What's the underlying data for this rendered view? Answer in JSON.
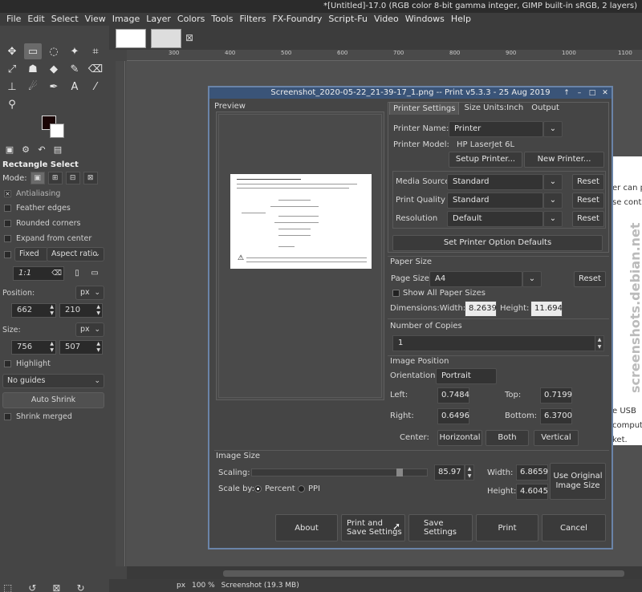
{
  "window": {
    "title": "*[Untitled]-17.0 (RGB color 8-bit gamma integer, GIMP built-in sRGB, 2 layers)"
  },
  "menu": [
    "File",
    "Edit",
    "Select",
    "View",
    "Image",
    "Layer",
    "Colors",
    "Tools",
    "Filters",
    "FX-Foundry",
    "Script-Fu",
    "Video",
    "Windows",
    "Help"
  ],
  "toolbox": {
    "tool_icons": [
      "move",
      "rect-select",
      "lasso",
      "fuzzy-select",
      "crop",
      "transform",
      "warp",
      "bucket",
      "paintbrush",
      "eraser",
      "clone",
      "smudge",
      "path",
      "text",
      "color-picker",
      "zoom"
    ],
    "tool_options": {
      "title": "Rectangle Select",
      "mode_label": "Mode:",
      "antialiasing": "Antialiasing",
      "feather_edges": "Feather edges",
      "rounded_corners": "Rounded corners",
      "expand_from_center": "Expand from center",
      "fixed": "Fixed",
      "fixed_mode": "Aspect ratio",
      "ratio": "1:1",
      "position_label": "Position:",
      "position_unit": "px",
      "pos_x": "662",
      "pos_y": "210",
      "size_label": "Size:",
      "size_unit": "px",
      "size_w": "756",
      "size_h": "507",
      "highlight": "Highlight",
      "guides": "No guides",
      "auto_shrink": "Auto Shrink",
      "shrink_merged": "Shrink merged"
    }
  },
  "ruler": {
    "marks": [
      "300",
      "400",
      "500",
      "600",
      "700",
      "800",
      "900",
      "1000",
      "1100"
    ]
  },
  "statusbar": {
    "unit": "px",
    "zoom": "100 %",
    "info": "Screenshot (19.3 MB)"
  },
  "image_text": [
    "er can p",
    "se cont",
    "e USB",
    "comput",
    "ket."
  ],
  "watermark": "screenshots.debian.net",
  "dialog": {
    "title": "Screenshot_2020-05-22_21-39-17_1.png -- Print v5.3.3 - 25 Aug 2019",
    "preview_label": "Preview",
    "tabs": [
      "Printer Settings",
      "Size Units:Inch",
      "Output"
    ],
    "printer_name_label": "Printer Name:",
    "printer_name": "Printer",
    "printer_model_label": "Printer Model:",
    "printer_model": "HP LaserJet 6L",
    "setup_printer": "Setup Printer...",
    "new_printer": "New Printer...",
    "media_source_label": "Media Source",
    "media_source": "Standard",
    "print_quality_label": "Print Quality",
    "print_quality": "Standard",
    "resolution_label": "Resolution",
    "resolution": "Default",
    "reset": "Reset",
    "set_defaults": "Set Printer Option Defaults",
    "paper_size_section": "Paper Size",
    "page_size_label": "Page Size",
    "page_size": "A4",
    "show_all_sizes": "Show All Paper Sizes",
    "dimensions_label": "Dimensions:Width:",
    "dim_width": "8.2639",
    "height_label": "Height:",
    "dim_height": "11.694",
    "copies_section": "Number of Copies",
    "copies": "1",
    "image_position_section": "Image Position",
    "orientation_label": "Orientation:",
    "orientation": "Portrait",
    "left_label": "Left:",
    "left": "0.7484",
    "top_label": "Top:",
    "top": "0.7199",
    "right_label": "Right:",
    "right": "0.6496",
    "bottom_label": "Bottom:",
    "bottom": "6.3700",
    "center_label": "Center:",
    "center_buttons": [
      "Horizontal",
      "Both",
      "Vertical"
    ],
    "image_size_section": "Image Size",
    "scaling_label": "Scaling:",
    "scaling_fraction": 0.85,
    "scaling": "85.97",
    "scale_by_label": "Scale by:",
    "percent": "Percent",
    "ppi": "PPI",
    "width_label": "Width:",
    "img_width": "6.8659",
    "img_height_label": "Height:",
    "img_height": "4.6045",
    "use_original": "Use Original Image Size",
    "buttons": {
      "about": "About",
      "print_save_1": "Print and",
      "print_save_2": "Save Settings",
      "save_1": "Save",
      "save_2": "Settings",
      "print": "Print",
      "cancel": "Cancel"
    }
  }
}
